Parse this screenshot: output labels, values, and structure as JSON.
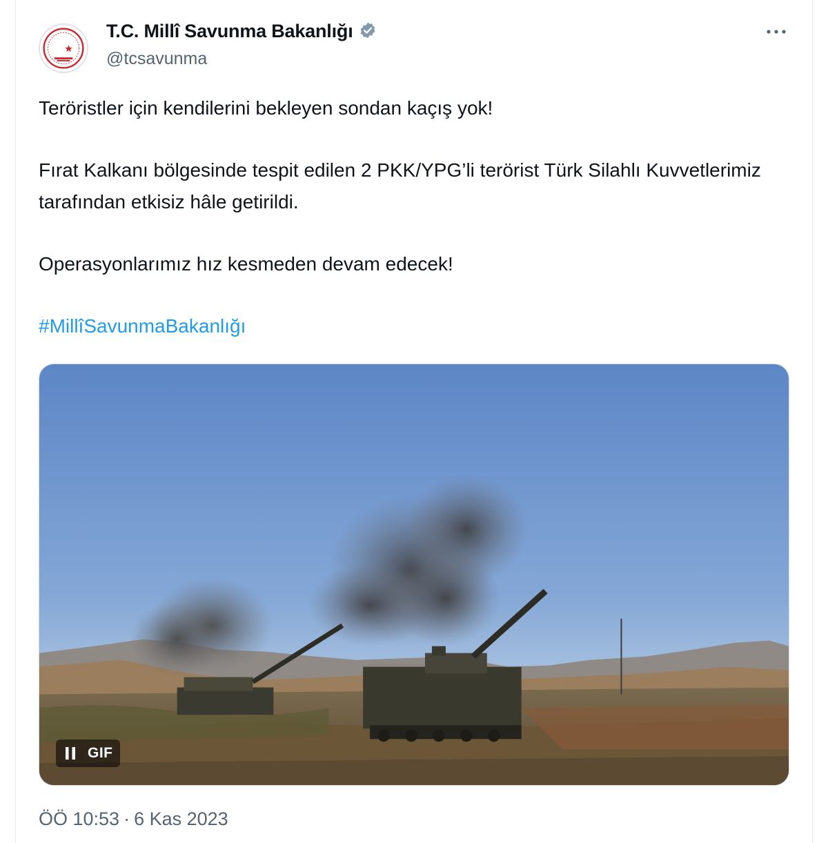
{
  "tweet": {
    "author": {
      "display_name": "T.C. Millî Savunma Bakanlığı",
      "handle": "@tcsavunma",
      "verified": true,
      "avatar_icon": "ministry-crescent-star-emblem"
    },
    "more_icon": "more-dots-icon",
    "text": {
      "line1": "Teröristler için kendilerini bekleyen sondan kaçış yok!",
      "line2": "Fırat Kalkanı bölgesinde tespit edilen 2 PKK/YPG’li terörist Türk Silahlı Kuvvetlerimiz tarafından etkisiz hâle getirildi.",
      "line3": "Operasyonlarımız hız kesmeden devam edecek!",
      "hashtag": "#MillîSavunmaBakanlığı"
    },
    "media": {
      "type": "gif",
      "description_icon": "artillery-howitzers-firing-image",
      "gif_label": "GIF",
      "pause_icon": "pause-icon"
    },
    "time": "ÖÖ 10:53",
    "separator": "·",
    "date": "6 Kas 2023"
  },
  "colors": {
    "link": "#1d9bf0",
    "text": "#0f1419",
    "secondary": "#536471",
    "verified_badge": "#829aab",
    "emblem_red": "#d2232a"
  }
}
